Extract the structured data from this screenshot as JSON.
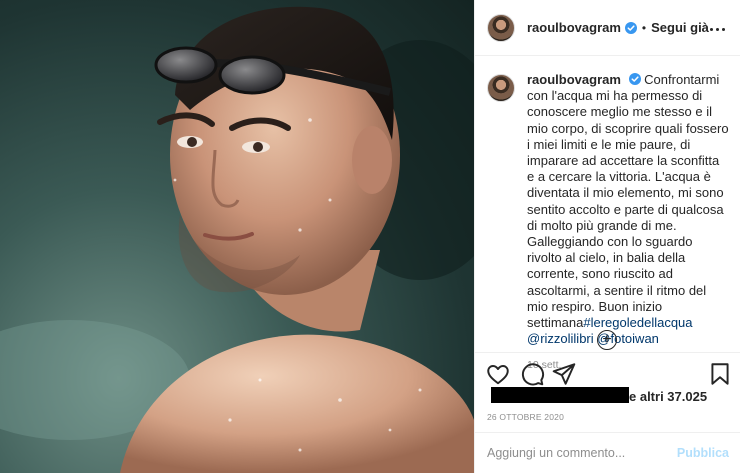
{
  "header": {
    "username": "raoulbovagram",
    "separator": "•",
    "follow_label": "Segui già"
  },
  "caption": {
    "username": "raoulbovagram",
    "text": "Confrontarmi con l'acqua mi ha permesso di conoscere meglio me stesso e il mio corpo, di scoprire quali fossero i miei limiti e le mie paure, di imparare ad accettare la sconfitta e a cercare la vittoria. L'acqua è diventata il mio elemento, mi sono sentito accolto e parte di qualcosa di molto più grande di me. Galleggiando con lo sguardo rivolto al cielo, in balia della corrente, sono riuscito ad ascoltarmi, a sentire il ritmo del mio respiro. Buon inizio settimana",
    "hashtag": "#leregoledellacqua",
    "mention_1": "@rizzolilibri",
    "mention_2": "@fotoiwan",
    "time": "10 sett."
  },
  "load_more_symbol": "+",
  "likes": {
    "text": "e altri 37.025"
  },
  "date": "26 OTTOBRE 2020",
  "comment_box": {
    "placeholder": "Aggiungi un commento...",
    "publish_label": "Pubblica"
  },
  "icons": {
    "verified": "verified-badge-icon",
    "more": "more-options-icon",
    "like": "heart-icon",
    "comment": "comment-bubble-icon",
    "share": "paper-plane-icon",
    "save": "bookmark-icon",
    "load_more": "plus-circle-icon"
  },
  "colors": {
    "verified_blue": "#3897f0",
    "link_blue": "#00376b",
    "publish_disabled": "#b2dffc",
    "muted_text": "#8e8e8e"
  }
}
